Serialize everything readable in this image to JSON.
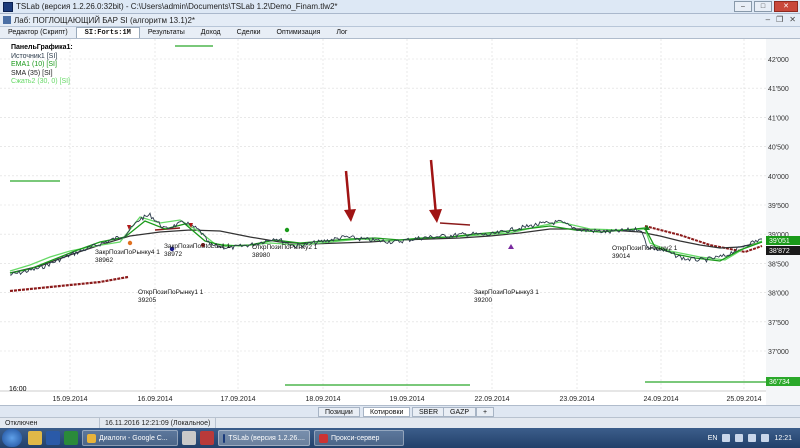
{
  "window": {
    "title": "TSLab (версия 1.2.26.0:32bit) - C:\\Users\\admin\\Documents\\TSLab 1.2\\Demo_Finam.tlw2*",
    "minimize": "–",
    "maximize": "□",
    "close": "✕"
  },
  "document": {
    "title": "Лаб: ПОГЛОЩАЮЩИЙ БАР SI  (алгоритм 13.1)2*",
    "minimize": "–",
    "restore": "❐",
    "close": "✕"
  },
  "tabs": [
    {
      "label": "Редактор (Скрипт)"
    },
    {
      "label": "SI:Forts:1M"
    },
    {
      "label": "Результаты"
    },
    {
      "label": "Доход"
    },
    {
      "label": "Сделки"
    },
    {
      "label": "Оптимизация"
    },
    {
      "label": "Лог"
    }
  ],
  "legend": {
    "title": "ПанельГрафика1:",
    "items": [
      {
        "label": "Источник1 [SI]",
        "color": "#2b3a4a"
      },
      {
        "label": "EMA1 (10) [SI]",
        "color": "#1a9a1a"
      },
      {
        "label": "SMA (35) [SI]",
        "color": "#222222"
      },
      {
        "label": "Сжать2 (30, 0) [SI]",
        "color": "#66d966"
      }
    ]
  },
  "annotations": [
    {
      "line1": "ЗакрПозиПоРынку4 1",
      "line2": "38962"
    },
    {
      "line1": "ЗакрПозиПоStoLos1 1",
      "line2": "38972"
    },
    {
      "line1": "ОткрПозиПоРынку2 1",
      "line2": "38980"
    },
    {
      "line1": "ОткрПозиПоРынку2 1",
      "line2": "39014"
    },
    {
      "line1": "ОткрПозиПоРынку1 1",
      "line2": "39205"
    },
    {
      "line1": "ЗакрПозиПоРынку3 1",
      "line2": "39200"
    }
  ],
  "time_label": "16:00",
  "y_axis": {
    "ticks": [
      "42'000",
      "41'500",
      "41'000",
      "40'500",
      "40'000",
      "39'500",
      "39'000",
      "38'500",
      "38'000",
      "37'500",
      "37'000"
    ],
    "price_badges": [
      {
        "value": "39'051",
        "color": "#1a9a1a"
      },
      {
        "value": "38'872",
        "color": "#1a1a1a"
      },
      {
        "value": "36'734",
        "color": "#2aa82a"
      }
    ]
  },
  "x_axis": {
    "ticks": [
      "15.09.2014",
      "16.09.2014",
      "17.09.2014",
      "18.09.2014",
      "19.09.2014",
      "22.09.2014",
      "23.09.2014",
      "24.09.2014",
      "25.09.2014"
    ]
  },
  "colors": {
    "price": "#2b3a4a",
    "ema": "#1a9a1a",
    "sma": "#333333",
    "compressed": "#66d966",
    "stop_line": "#8b1a1a",
    "arrow": "#a01414",
    "grid": "#d9d9d9"
  },
  "bottom_tabs": [
    {
      "label": "Позиции"
    },
    {
      "label": "Котировки"
    },
    {
      "label": "SBER"
    },
    {
      "label": "GAZP"
    }
  ],
  "add_tab": "+",
  "status": {
    "connection": "Отключен",
    "datetime": "16.11.2016 12:21:09 (Локальное)"
  },
  "taskbar": {
    "tasks": [
      {
        "label": "Диалоги - Google C...",
        "color": "#e8b33a"
      },
      {
        "label": "TSLab (версия 1.2.26....",
        "color": "#1a3a7a"
      },
      {
        "label": "Прокси-сервер",
        "color": "#cc3333"
      }
    ],
    "lang": "EN",
    "clock": "12:21"
  }
}
